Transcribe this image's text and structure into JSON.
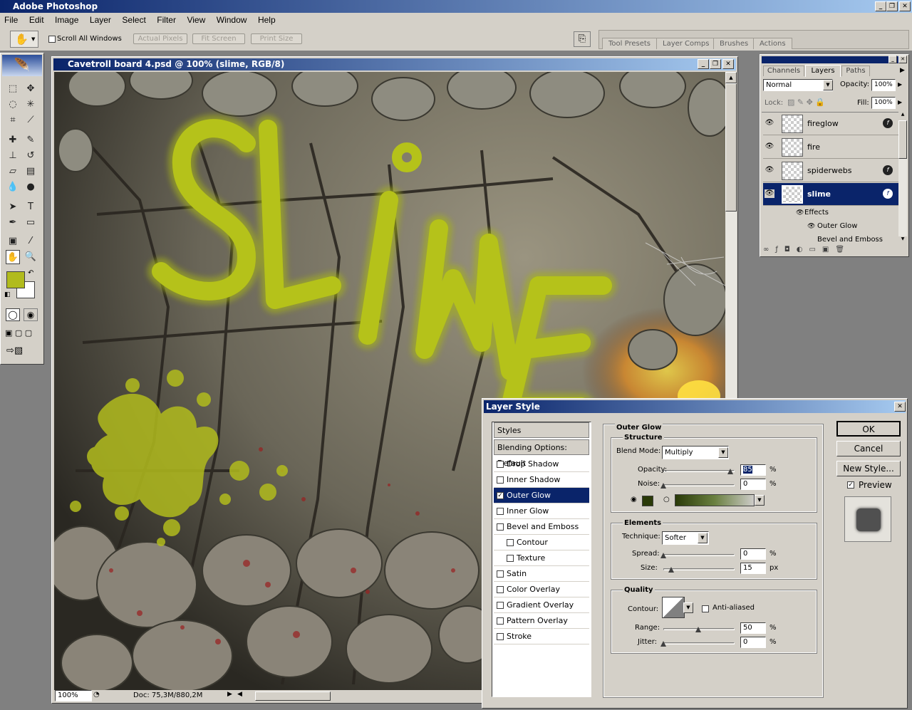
{
  "app": {
    "title": "Adobe Photoshop"
  },
  "menu": [
    "File",
    "Edit",
    "Image",
    "Layer",
    "Select",
    "Filter",
    "View",
    "Window",
    "Help"
  ],
  "options": {
    "scroll_all_label": "Scroll All Windows",
    "actual_pixels": "Actual Pixels",
    "fit_screen": "Fit Screen",
    "print_size": "Print Size",
    "well_tabs": [
      "Tool Presets",
      "Layer Comps",
      "Brushes",
      "Actions"
    ]
  },
  "document": {
    "title": "Cavetroll board 4.psd @ 100% (slime, RGB/8)",
    "canvas_text": "SLiME",
    "zoom": "100%",
    "doc_size": "Doc: 75,3M/880,2M"
  },
  "colors": {
    "foreground": "#b1bb1d",
    "background": "#ffffff",
    "slime": "#b5c21a",
    "accent": "#0a246a"
  },
  "layers_panel": {
    "tabs": [
      "Channels",
      "Layers",
      "Paths"
    ],
    "blend_mode": "Normal",
    "opacity_label": "Opacity:",
    "opacity": "100%",
    "lock_label": "Lock:",
    "fill_label": "Fill:",
    "fill": "100%",
    "layers": [
      {
        "name": "fireglow",
        "fx": true,
        "selected": false
      },
      {
        "name": "fire",
        "fx": false,
        "selected": false
      },
      {
        "name": "spiderwebs",
        "fx": true,
        "selected": false
      },
      {
        "name": "slime",
        "fx": true,
        "selected": true
      }
    ],
    "effects_label": "Effects",
    "effects": [
      "Outer Glow",
      "Bevel and Emboss"
    ]
  },
  "layer_style": {
    "title": "Layer Style",
    "styles_header": "Styles",
    "blending_options": "Blending Options: Default",
    "items": [
      {
        "label": "Drop Shadow",
        "checked": false,
        "indent": false
      },
      {
        "label": "Inner Shadow",
        "checked": false,
        "indent": false
      },
      {
        "label": "Outer Glow",
        "checked": true,
        "indent": false,
        "selected": true
      },
      {
        "label": "Inner Glow",
        "checked": false,
        "indent": false
      },
      {
        "label": "Bevel and Emboss",
        "checked": false,
        "indent": false
      },
      {
        "label": "Contour",
        "checked": false,
        "indent": true
      },
      {
        "label": "Texture",
        "checked": false,
        "indent": true
      },
      {
        "label": "Satin",
        "checked": false,
        "indent": false
      },
      {
        "label": "Color Overlay",
        "checked": false,
        "indent": false
      },
      {
        "label": "Gradient Overlay",
        "checked": false,
        "indent": false
      },
      {
        "label": "Pattern Overlay",
        "checked": false,
        "indent": false
      },
      {
        "label": "Stroke",
        "checked": false,
        "indent": false
      }
    ],
    "section_title": "Outer Glow",
    "structure": {
      "title": "Structure",
      "blend_mode_label": "Blend Mode:",
      "blend_mode": "Multiply",
      "opacity_label": "Opacity:",
      "opacity": "85",
      "noise_label": "Noise:",
      "noise": "0",
      "percent": "%",
      "glow_color": "#2a3a08"
    },
    "elements": {
      "title": "Elements",
      "technique_label": "Technique:",
      "technique": "Softer",
      "spread_label": "Spread:",
      "spread": "0",
      "size_label": "Size:",
      "size": "15",
      "px": "px"
    },
    "quality": {
      "title": "Quality",
      "contour_label": "Contour:",
      "anti_aliased": "Anti-aliased",
      "range_label": "Range:",
      "range": "50",
      "jitter_label": "Jitter:",
      "jitter": "0"
    },
    "buttons": {
      "ok": "OK",
      "cancel": "Cancel",
      "new_style": "New Style...",
      "preview": "Preview"
    }
  }
}
